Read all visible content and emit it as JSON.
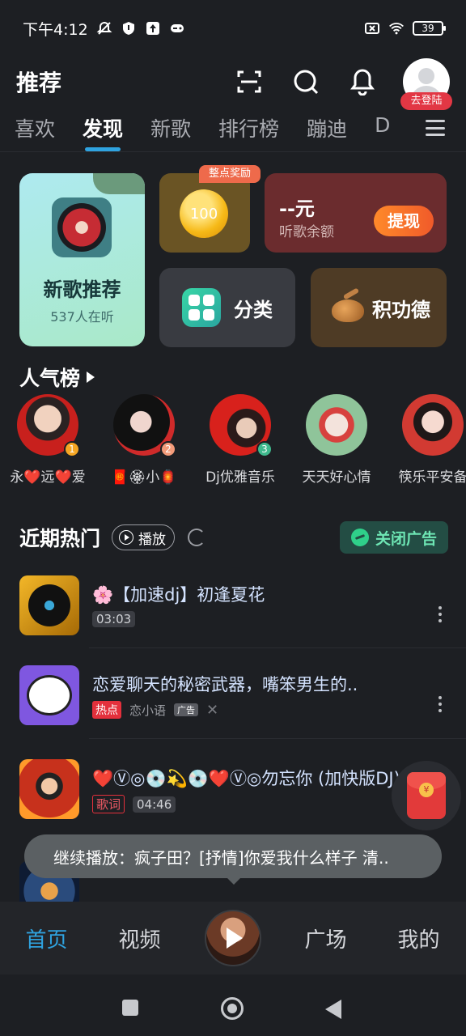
{
  "status_bar": {
    "time": "下午4:12",
    "battery": "39"
  },
  "header": {
    "title": "推荐",
    "login_badge": "去登陆"
  },
  "tabs": [
    "喜欢",
    "发现",
    "新歌",
    "排行榜",
    "蹦迪",
    "D"
  ],
  "cards": {
    "new_song": {
      "title": "新歌推荐",
      "listeners": "537人在听"
    },
    "coin": {
      "value": "100",
      "tag": "整点奖励"
    },
    "balance": {
      "amount": "--元",
      "label": "听歌余额",
      "button": "提现"
    },
    "category": {
      "label": "分类"
    },
    "merit": {
      "label": "积功德"
    }
  },
  "popular": {
    "title": "人气榜",
    "items": [
      {
        "name": "永❤️远❤️爱",
        "rank": "1"
      },
      {
        "name": "🧧🏵小🏮",
        "rank": "2"
      },
      {
        "name": "Dj优雅音乐",
        "rank": "3"
      },
      {
        "name": "天天好心情",
        "rank": ""
      },
      {
        "name": "筷乐平安备",
        "rank": ""
      }
    ]
  },
  "recent_hot": {
    "title": "近期热门",
    "play_label": "播放",
    "close_ad_label": "关闭广告",
    "songs": [
      {
        "title": "🌸【加速dj】初逢夏花",
        "duration": "03:03"
      },
      {
        "title": "恋爱聊天的秘密武器，嘴笨男生的..",
        "hot_tag": "热点",
        "source": "恋小语",
        "ad_tag": "广告"
      },
      {
        "title": "❤️Ⓥ◎💿💫💿❤️Ⓥ◎勿忘你 (加快版DJ)",
        "lyric_tag": "歌词",
        "duration": "04:46"
      }
    ]
  },
  "toast": "继续播放：疯子田？[抒情]你爱我什么样子 清..",
  "bottom_nav": {
    "home": "首页",
    "video": "视频",
    "square": "广场",
    "mine": "我的"
  }
}
